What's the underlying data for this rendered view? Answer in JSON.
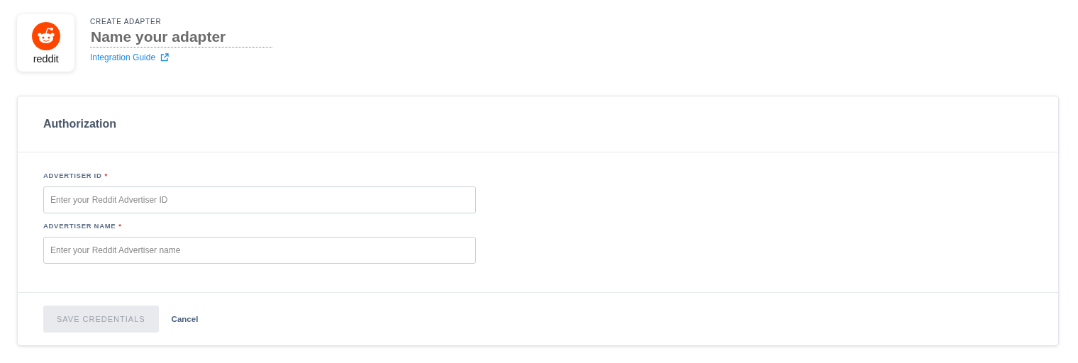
{
  "header": {
    "logo_text": "reddit",
    "eyebrow": "CREATE ADAPTER",
    "name_placeholder": "Name your adapter",
    "guide_link": "Integration Guide"
  },
  "card": {
    "title": "Authorization",
    "fields": [
      {
        "label": "ADVERTISER ID",
        "required_mark": "*",
        "placeholder": "Enter your Reddit Advertiser ID"
      },
      {
        "label": "ADVERTISER NAME",
        "required_mark": "*",
        "placeholder": "Enter your Reddit Advertiser name"
      }
    ],
    "save_button": {
      "label": "SAVE CREDENTIALS",
      "disabled": true
    },
    "cancel_link": "Cancel"
  }
}
